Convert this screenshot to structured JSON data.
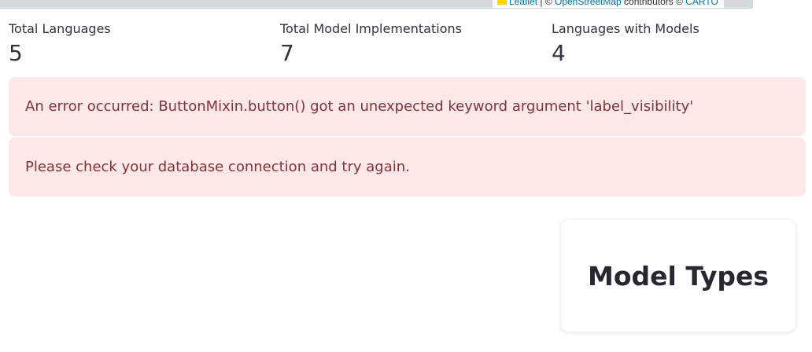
{
  "map": {
    "attribution": {
      "leaflet": "Leaflet",
      "sep1": " | © ",
      "osm": "OpenStreetMap",
      "contributors": " contributors © ",
      "carto": "CARTO"
    }
  },
  "metrics": [
    {
      "label": "Total Languages",
      "value": "5"
    },
    {
      "label": "Total Model Implementations",
      "value": "7"
    },
    {
      "label": "Languages with Models",
      "value": "4"
    }
  ],
  "alerts": {
    "error": "An error occurred: ButtonMixin.button() got an unexpected keyword argument 'label_visibility'",
    "hint": "Please check your database connection and try again."
  },
  "card": {
    "title": "Model Types"
  }
}
